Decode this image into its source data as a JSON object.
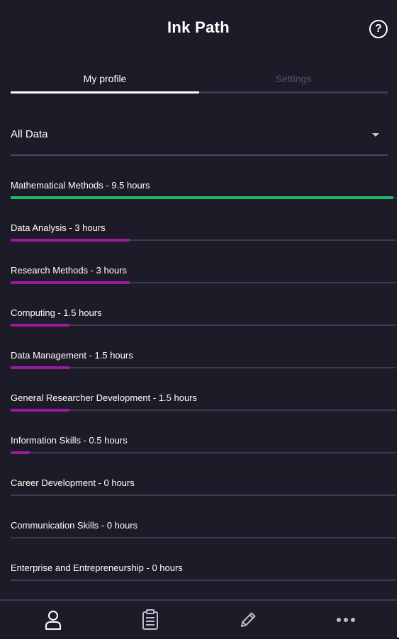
{
  "header": {
    "title": "Ink Path",
    "help_icon": "help-circle-icon"
  },
  "tabs": [
    {
      "label": "My profile",
      "active": true
    },
    {
      "label": "Settings",
      "active": false
    }
  ],
  "filter": {
    "selected": "All Data",
    "icon": "dropdown-caret-icon"
  },
  "colors": {
    "background": "#1c1b27",
    "complete": "#1db866",
    "progress": "#9c1a9e",
    "track": "#3d3c4e",
    "tab_inactive": "#55546a"
  },
  "max_hours": 9.5,
  "categories": [
    {
      "label": "Mathematical Methods - 9.5 hours",
      "hours": 9.5,
      "color": "#1db866"
    },
    {
      "label": "Data Analysis - 3 hours",
      "hours": 3,
      "color": "#9c1a9e"
    },
    {
      "label": "Research Methods - 3 hours",
      "hours": 3,
      "color": "#9c1a9e"
    },
    {
      "label": "Computing - 1.5 hours",
      "hours": 1.5,
      "color": "#9c1a9e"
    },
    {
      "label": "Data Management - 1.5 hours",
      "hours": 1.5,
      "color": "#9c1a9e"
    },
    {
      "label": "General Researcher Development - 1.5 hours",
      "hours": 1.5,
      "color": "#9c1a9e"
    },
    {
      "label": "Information Skills - 0.5 hours",
      "hours": 0.5,
      "color": "#9c1a9e"
    },
    {
      "label": "Career Development - 0 hours",
      "hours": 0,
      "color": "#9c1a9e"
    },
    {
      "label": "Communication Skills - 0 hours",
      "hours": 0,
      "color": "#9c1a9e"
    },
    {
      "label": "Enterprise and Entrepreneurship - 0 hours",
      "hours": 0,
      "color": "#9c1a9e"
    }
  ],
  "bottom_nav": [
    {
      "icon": "profile-icon"
    },
    {
      "icon": "clipboard-icon"
    },
    {
      "icon": "pencil-icon"
    },
    {
      "icon": "more-icon"
    }
  ]
}
